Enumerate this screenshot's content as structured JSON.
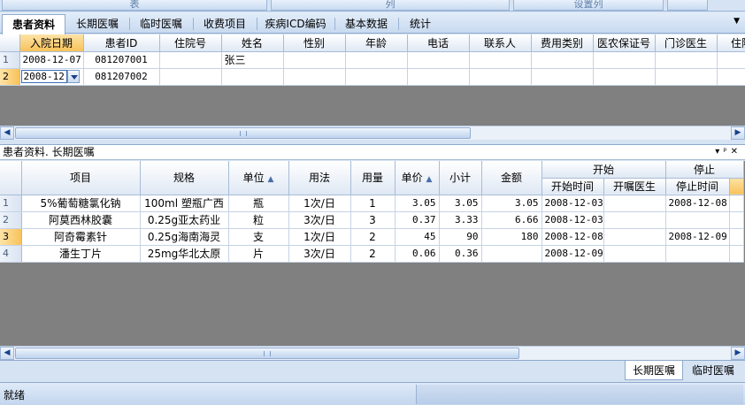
{
  "toolbar": {
    "table_label": "表",
    "column_label": "列",
    "set_column_label": "设置列"
  },
  "tabs": [
    {
      "label": "患者资料"
    },
    {
      "label": "长期医嘱"
    },
    {
      "label": "临时医嘱"
    },
    {
      "label": "收费项目"
    },
    {
      "label": "疾病ICD编码"
    },
    {
      "label": "基本数据"
    },
    {
      "label": "统计"
    }
  ],
  "patients": {
    "columns": [
      "入院日期",
      "患者ID",
      "住院号",
      "姓名",
      "性别",
      "年龄",
      "电话",
      "联系人",
      "费用类别",
      "医农保证号",
      "门诊医生",
      "住院"
    ],
    "rows": [
      {
        "num": "1",
        "date": "2008-12-07",
        "id": "081207001",
        "inpatient_no": "",
        "name": "张三"
      },
      {
        "num": "2",
        "date": "2008-12",
        "id": "081207002",
        "inpatient_no": "",
        "name": ""
      }
    ]
  },
  "panel": {
    "title": "患者资料. 长期医嘱"
  },
  "orders": {
    "columns": {
      "item": "项目",
      "spec": "规格",
      "unit": "单位",
      "usage": "用法",
      "qty": "用量",
      "price": "单价",
      "subtotal": "小计",
      "amount": "金额",
      "start_group": "开始",
      "stop_group": "停止",
      "start_time": "开始时间",
      "start_doctor": "开嘱医生",
      "stop_time": "停止时间"
    },
    "rows": [
      {
        "num": "1",
        "item": "5%葡萄糖氯化钠",
        "spec": "100ml 塑瓶广西",
        "unit": "瓶",
        "usage": "1次/日",
        "qty": "1",
        "price": "3.05",
        "subtotal": "3.05",
        "amount": "3.05",
        "start_time": "2008-12-03",
        "start_doctor": "",
        "stop_time": "2008-12-08"
      },
      {
        "num": "2",
        "item": "阿莫西林胶囊",
        "spec": "0.25g亚太药业",
        "unit": "粒",
        "usage": "3次/日",
        "qty": "3",
        "price": "0.37",
        "subtotal": "3.33",
        "amount": "6.66",
        "start_time": "2008-12-03",
        "start_doctor": "",
        "stop_time": ""
      },
      {
        "num": "3",
        "item": "阿奇霉素针",
        "spec": "0.25g海南海灵",
        "unit": "支",
        "usage": "1次/日",
        "qty": "2",
        "price": "45",
        "subtotal": "90",
        "amount": "180",
        "start_time": "2008-12-08",
        "start_doctor": "",
        "stop_time": "2008-12-09"
      },
      {
        "num": "4",
        "item": "潘生丁片",
        "spec": "25mg华北太原",
        "unit": "片",
        "usage": "3次/日",
        "qty": "2",
        "price": "0.06",
        "subtotal": "0.36",
        "amount": "",
        "start_time": "2008-12-09",
        "start_doctor": "",
        "stop_time": ""
      }
    ]
  },
  "bottom_tabs": [
    {
      "label": "长期医嘱"
    },
    {
      "label": "临时医嘱"
    }
  ],
  "status": {
    "text": "就绪"
  },
  "colors": {
    "highlight": "#f8c25a",
    "grid_empty": "#808080",
    "chrome": "#d6e3f3"
  }
}
